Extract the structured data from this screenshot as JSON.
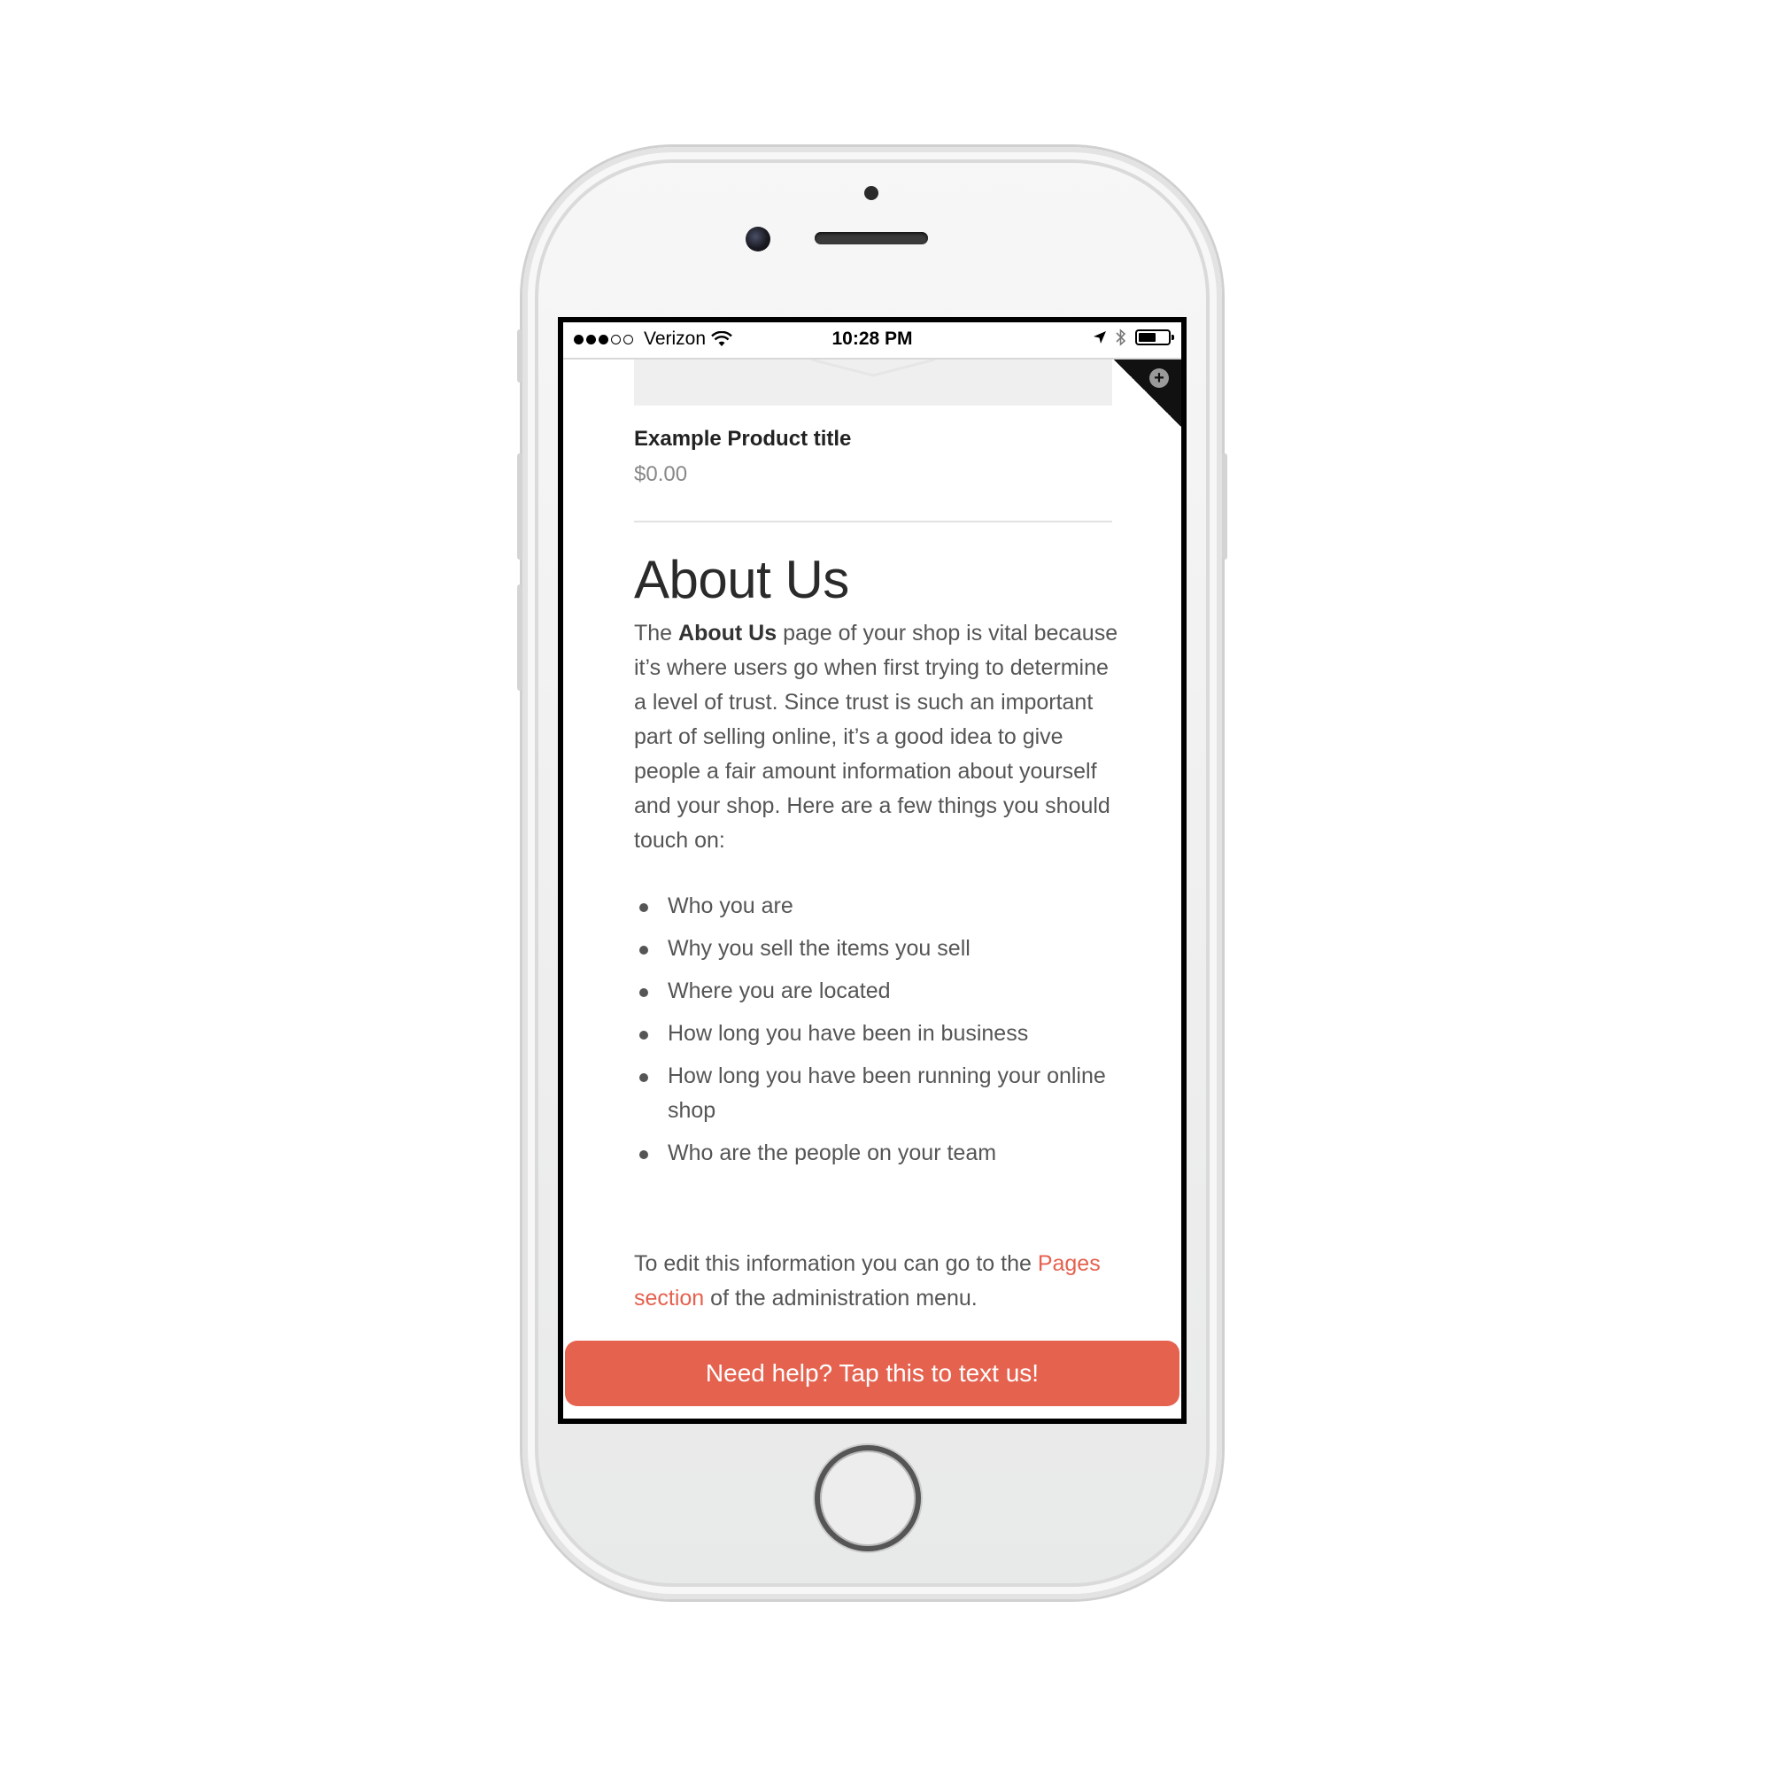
{
  "status_bar": {
    "carrier": "Verizon",
    "time": "10:28 PM",
    "signal_bars": 3,
    "signal_total": 5,
    "battery_level": 0.6
  },
  "product": {
    "title": "Example Product title",
    "price": "$0.00"
  },
  "about": {
    "heading": "About Us",
    "intro_prefix": "The ",
    "intro_bold": "About Us",
    "intro_rest": " page of your shop is vital because it’s where users go when first trying to determine a level of trust. Since trust is such an important part of selling online, it’s a good idea to give people a fair amount information about yourself and your shop. Here are a few things you should touch on:",
    "bullets": [
      "Who you are",
      "Why you sell the items you sell",
      "Where you are located",
      "How long you have been in business",
      "How long you have been running your online shop",
      "Who are the people on your team"
    ],
    "edit_prefix": "To edit this information you can go to the ",
    "edit_link": "Pages section",
    "edit_suffix": " of the administration menu."
  },
  "help_button": {
    "label": "Need help? Tap this to text us!"
  },
  "colors": {
    "accent": "#e5624f",
    "link": "#e5604e",
    "text": "#555555"
  }
}
